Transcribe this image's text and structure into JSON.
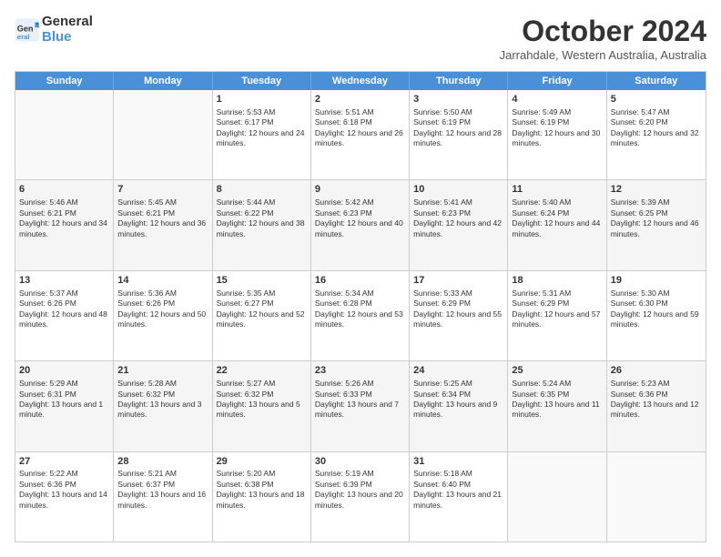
{
  "header": {
    "logo_line1": "General",
    "logo_line2": "Blue",
    "month": "October 2024",
    "location": "Jarrahdale, Western Australia, Australia"
  },
  "days": [
    "Sunday",
    "Monday",
    "Tuesday",
    "Wednesday",
    "Thursday",
    "Friday",
    "Saturday"
  ],
  "rows": [
    [
      {
        "day": "",
        "data": "",
        "empty": true
      },
      {
        "day": "",
        "data": "",
        "empty": true
      },
      {
        "day": "1",
        "data": "Sunrise: 5:53 AM\nSunset: 6:17 PM\nDaylight: 12 hours and 24 minutes."
      },
      {
        "day": "2",
        "data": "Sunrise: 5:51 AM\nSunset: 6:18 PM\nDaylight: 12 hours and 26 minutes."
      },
      {
        "day": "3",
        "data": "Sunrise: 5:50 AM\nSunset: 6:19 PM\nDaylight: 12 hours and 28 minutes."
      },
      {
        "day": "4",
        "data": "Sunrise: 5:49 AM\nSunset: 6:19 PM\nDaylight: 12 hours and 30 minutes."
      },
      {
        "day": "5",
        "data": "Sunrise: 5:47 AM\nSunset: 6:20 PM\nDaylight: 12 hours and 32 minutes."
      }
    ],
    [
      {
        "day": "6",
        "data": "Sunrise: 5:46 AM\nSunset: 6:21 PM\nDaylight: 12 hours and 34 minutes."
      },
      {
        "day": "7",
        "data": "Sunrise: 5:45 AM\nSunset: 6:21 PM\nDaylight: 12 hours and 36 minutes."
      },
      {
        "day": "8",
        "data": "Sunrise: 5:44 AM\nSunset: 6:22 PM\nDaylight: 12 hours and 38 minutes."
      },
      {
        "day": "9",
        "data": "Sunrise: 5:42 AM\nSunset: 6:23 PM\nDaylight: 12 hours and 40 minutes."
      },
      {
        "day": "10",
        "data": "Sunrise: 5:41 AM\nSunset: 6:23 PM\nDaylight: 12 hours and 42 minutes."
      },
      {
        "day": "11",
        "data": "Sunrise: 5:40 AM\nSunset: 6:24 PM\nDaylight: 12 hours and 44 minutes."
      },
      {
        "day": "12",
        "data": "Sunrise: 5:39 AM\nSunset: 6:25 PM\nDaylight: 12 hours and 46 minutes."
      }
    ],
    [
      {
        "day": "13",
        "data": "Sunrise: 5:37 AM\nSunset: 6:26 PM\nDaylight: 12 hours and 48 minutes."
      },
      {
        "day": "14",
        "data": "Sunrise: 5:36 AM\nSunset: 6:26 PM\nDaylight: 12 hours and 50 minutes."
      },
      {
        "day": "15",
        "data": "Sunrise: 5:35 AM\nSunset: 6:27 PM\nDaylight: 12 hours and 52 minutes."
      },
      {
        "day": "16",
        "data": "Sunrise: 5:34 AM\nSunset: 6:28 PM\nDaylight: 12 hours and 53 minutes."
      },
      {
        "day": "17",
        "data": "Sunrise: 5:33 AM\nSunset: 6:29 PM\nDaylight: 12 hours and 55 minutes."
      },
      {
        "day": "18",
        "data": "Sunrise: 5:31 AM\nSunset: 6:29 PM\nDaylight: 12 hours and 57 minutes."
      },
      {
        "day": "19",
        "data": "Sunrise: 5:30 AM\nSunset: 6:30 PM\nDaylight: 12 hours and 59 minutes."
      }
    ],
    [
      {
        "day": "20",
        "data": "Sunrise: 5:29 AM\nSunset: 6:31 PM\nDaylight: 13 hours and 1 minute."
      },
      {
        "day": "21",
        "data": "Sunrise: 5:28 AM\nSunset: 6:32 PM\nDaylight: 13 hours and 3 minutes."
      },
      {
        "day": "22",
        "data": "Sunrise: 5:27 AM\nSunset: 6:32 PM\nDaylight: 13 hours and 5 minutes."
      },
      {
        "day": "23",
        "data": "Sunrise: 5:26 AM\nSunset: 6:33 PM\nDaylight: 13 hours and 7 minutes."
      },
      {
        "day": "24",
        "data": "Sunrise: 5:25 AM\nSunset: 6:34 PM\nDaylight: 13 hours and 9 minutes."
      },
      {
        "day": "25",
        "data": "Sunrise: 5:24 AM\nSunset: 6:35 PM\nDaylight: 13 hours and 11 minutes."
      },
      {
        "day": "26",
        "data": "Sunrise: 5:23 AM\nSunset: 6:36 PM\nDaylight: 13 hours and 12 minutes."
      }
    ],
    [
      {
        "day": "27",
        "data": "Sunrise: 5:22 AM\nSunset: 6:36 PM\nDaylight: 13 hours and 14 minutes."
      },
      {
        "day": "28",
        "data": "Sunrise: 5:21 AM\nSunset: 6:37 PM\nDaylight: 13 hours and 16 minutes."
      },
      {
        "day": "29",
        "data": "Sunrise: 5:20 AM\nSunset: 6:38 PM\nDaylight: 13 hours and 18 minutes."
      },
      {
        "day": "30",
        "data": "Sunrise: 5:19 AM\nSunset: 6:39 PM\nDaylight: 13 hours and 20 minutes."
      },
      {
        "day": "31",
        "data": "Sunrise: 5:18 AM\nSunset: 6:40 PM\nDaylight: 13 hours and 21 minutes."
      },
      {
        "day": "",
        "data": "",
        "empty": true
      },
      {
        "day": "",
        "data": "",
        "empty": true
      }
    ]
  ]
}
